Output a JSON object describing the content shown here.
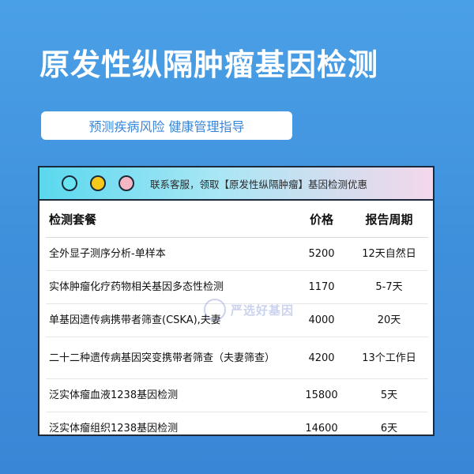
{
  "title": "原发性纵隔肿瘤基因检测",
  "subtitle": "预测疾病风险 健康管理指导",
  "panel": {
    "bar_text": "联系客服，领取【原发性纵隔肿瘤】基因检测优惠"
  },
  "table": {
    "headers": [
      "检测套餐",
      "价格",
      "报告周期"
    ],
    "rows": [
      {
        "name": "全外显子测序分析-单样本",
        "price": "5200",
        "period": "12天自然日"
      },
      {
        "name": "实体肿瘤化疗药物相关基因多态性检测",
        "price": "1170",
        "period": "5-7天"
      },
      {
        "name": "单基因遗传病携带者筛查(CSKA),夫妻",
        "price": "4000",
        "period": "20天"
      },
      {
        "name": "二十二种遗传病基因突变携带者筛查（夫妻筛查）",
        "price": "4200",
        "period": "13个工作日"
      },
      {
        "name": "泛实体瘤血液1238基因检测",
        "price": "15800",
        "period": "5天"
      },
      {
        "name": "泛实体瘤组织1238基因检测",
        "price": "14600",
        "period": "6天"
      }
    ]
  },
  "watermark": "严选好基因"
}
